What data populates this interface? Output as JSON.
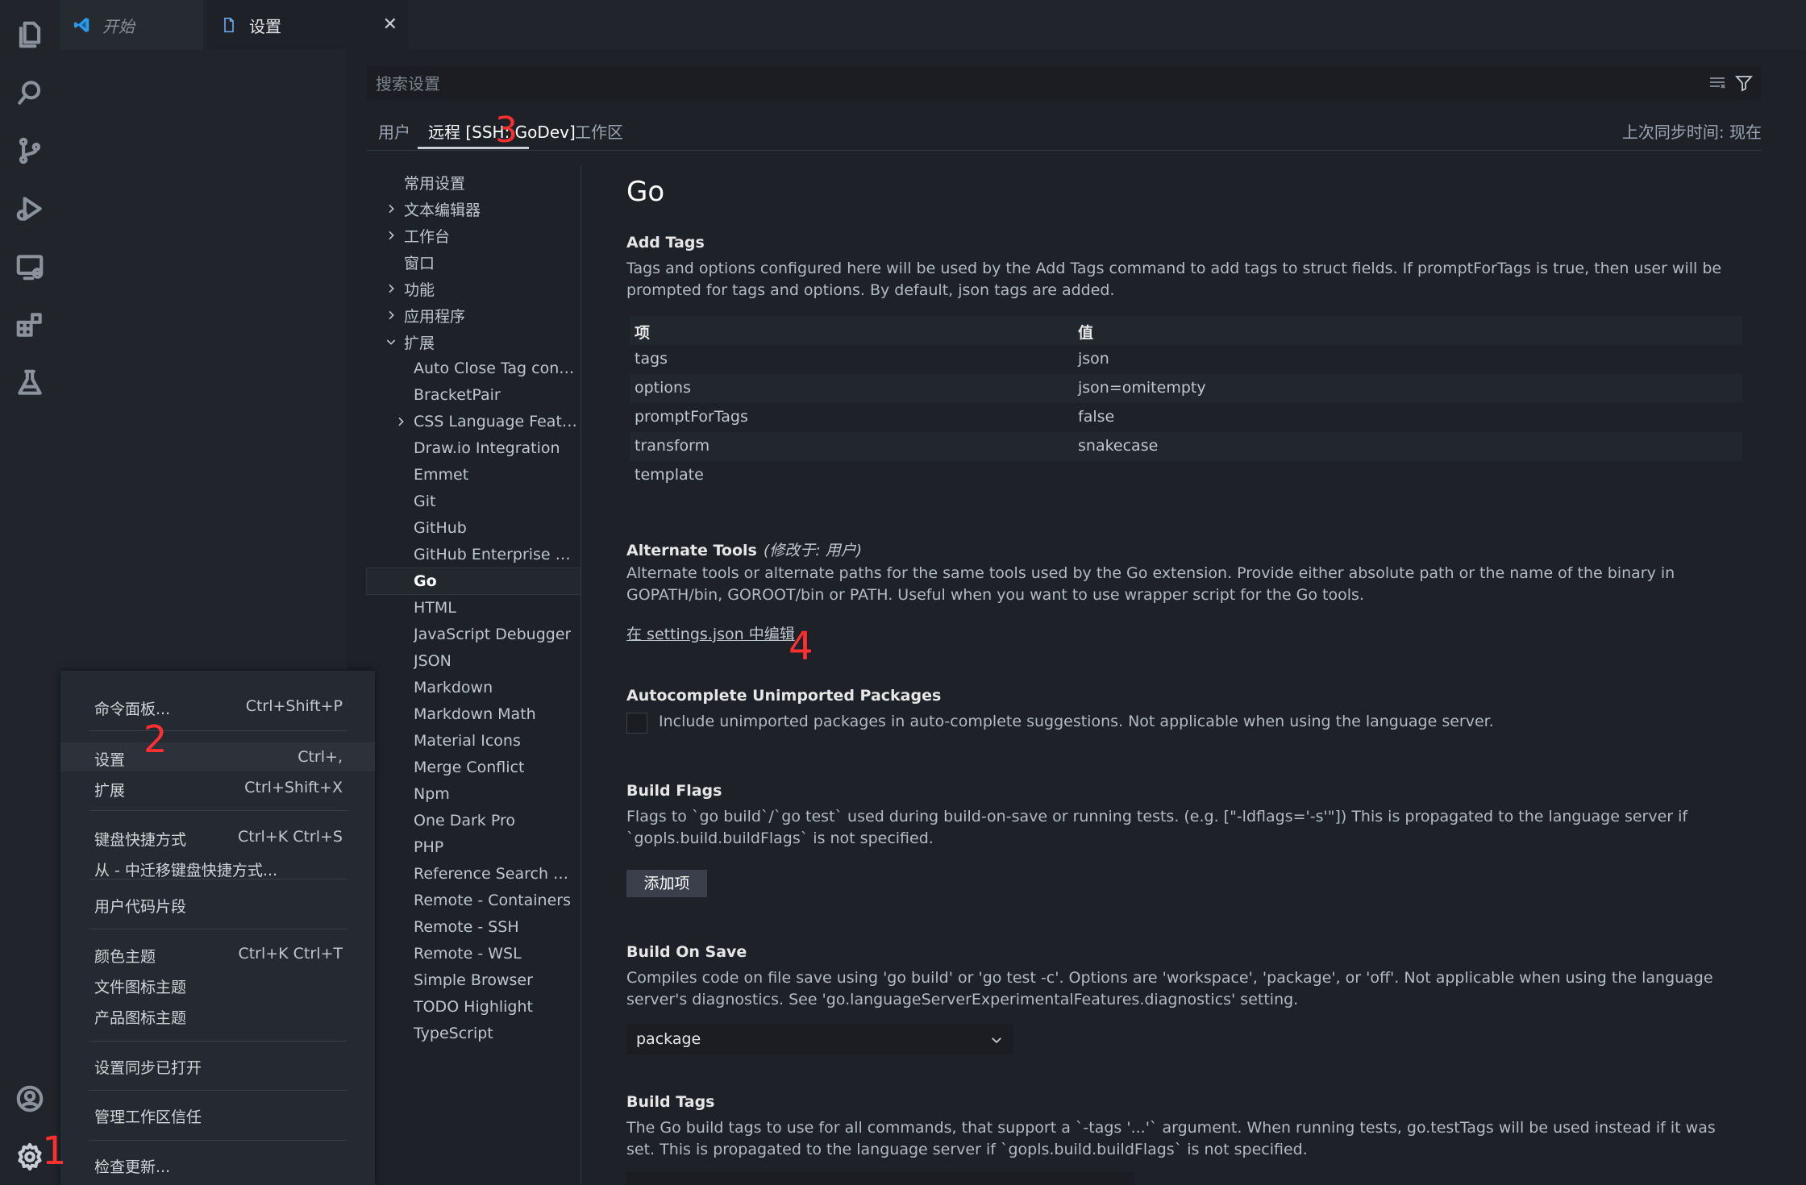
{
  "tabs": [
    {
      "label": "开始"
    },
    {
      "label": "设置"
    }
  ],
  "search": {
    "placeholder": "搜索设置"
  },
  "scope_tabs": [
    {
      "label": "用户"
    },
    {
      "label": "远程 [SSH: GoDev]"
    },
    {
      "label": "工作区"
    }
  ],
  "sync_status": "上次同步时间: 现在",
  "toc": [
    {
      "label": "常用设置",
      "indent": 0,
      "chevron": "none"
    },
    {
      "label": "文本编辑器",
      "indent": 0,
      "chevron": "right"
    },
    {
      "label": "工作台",
      "indent": 0,
      "chevron": "right"
    },
    {
      "label": "窗口",
      "indent": 0,
      "chevron": "none"
    },
    {
      "label": "功能",
      "indent": 0,
      "chevron": "right"
    },
    {
      "label": "应用程序",
      "indent": 0,
      "chevron": "right"
    },
    {
      "label": "扩展",
      "indent": 0,
      "chevron": "down"
    },
    {
      "label": "Auto Close Tag config...",
      "indent": 1,
      "chevron": "none"
    },
    {
      "label": "BracketPair",
      "indent": 1,
      "chevron": "none"
    },
    {
      "label": "CSS Language Features",
      "indent": 1,
      "chevron": "right"
    },
    {
      "label": "Draw.io Integration",
      "indent": 1,
      "chevron": "none"
    },
    {
      "label": "Emmet",
      "indent": 1,
      "chevron": "none"
    },
    {
      "label": "Git",
      "indent": 1,
      "chevron": "none"
    },
    {
      "label": "GitHub",
      "indent": 1,
      "chevron": "none"
    },
    {
      "label": "GitHub Enterprise Aut...",
      "indent": 1,
      "chevron": "none"
    },
    {
      "label": "Go",
      "indent": 1,
      "chevron": "none",
      "selected": true
    },
    {
      "label": "HTML",
      "indent": 1,
      "chevron": "none"
    },
    {
      "label": "JavaScript Debugger",
      "indent": 1,
      "chevron": "none"
    },
    {
      "label": "JSON",
      "indent": 1,
      "chevron": "none"
    },
    {
      "label": "Markdown",
      "indent": 1,
      "chevron": "none"
    },
    {
      "label": "Markdown Math",
      "indent": 1,
      "chevron": "none"
    },
    {
      "label": "Material Icons",
      "indent": 1,
      "chevron": "none"
    },
    {
      "label": "Merge Conflict",
      "indent": 1,
      "chevron": "none"
    },
    {
      "label": "Npm",
      "indent": 1,
      "chevron": "none"
    },
    {
      "label": "One Dark Pro",
      "indent": 1,
      "chevron": "none"
    },
    {
      "label": "PHP",
      "indent": 1,
      "chevron": "none"
    },
    {
      "label": "Reference Search View",
      "indent": 1,
      "chevron": "none"
    },
    {
      "label": "Remote - Containers",
      "indent": 1,
      "chevron": "none"
    },
    {
      "label": "Remote - SSH",
      "indent": 1,
      "chevron": "none"
    },
    {
      "label": "Remote - WSL",
      "indent": 1,
      "chevron": "none"
    },
    {
      "label": "Simple Browser",
      "indent": 1,
      "chevron": "none"
    },
    {
      "label": "TODO Highlight",
      "indent": 1,
      "chevron": "none"
    },
    {
      "label": "TypeScript",
      "indent": 1,
      "chevron": "none"
    }
  ],
  "content": {
    "heading": "Go",
    "add_tags": {
      "title": "Add Tags",
      "desc": "Tags and options configured here will be used by the Add Tags command to add tags to struct fields. If promptForTags is true, then user will be prompted for tags and options. By default, json tags are added.",
      "col_key": "项",
      "col_value": "值",
      "rows": [
        {
          "key": "tags",
          "value": "json"
        },
        {
          "key": "options",
          "value": "json=omitempty"
        },
        {
          "key": "promptForTags",
          "value": "false"
        },
        {
          "key": "transform",
          "value": "snakecase"
        },
        {
          "key": "template",
          "value": ""
        }
      ]
    },
    "alt_tools": {
      "title": "Alternate Tools",
      "modified": "(修改于: 用户)",
      "desc": "Alternate tools or alternate paths for the same tools used by the Go extension. Provide either absolute path or the name of the binary in GOPATH/bin, GOROOT/bin or PATH. Useful when you want to use wrapper script for the Go tools.",
      "link": "在 settings.json 中编辑"
    },
    "autocomplete": {
      "title": "Autocomplete Unimported Packages",
      "label": "Include unimported packages in auto-complete suggestions. Not applicable when using the language server."
    },
    "build_flags": {
      "title": "Build Flags",
      "desc": "Flags to `go build`/`go test` used during build-on-save or running tests. (e.g. [\"-ldflags='-s'\"]) This is propagated to the language server if `gopls.build.buildFlags` is not specified.",
      "button": "添加项"
    },
    "build_on_save": {
      "title": "Build On Save",
      "desc": "Compiles code on file save using 'go build' or 'go test -c'. Options are 'workspace', 'package', or 'off'. Not applicable when using the language server's diagnostics. See 'go.languageServerExperimentalFeatures.diagnostics' setting.",
      "value": "package"
    },
    "build_tags": {
      "title": "Build Tags",
      "desc": "The Go build tags to use for all commands, that support a `-tags '...'` argument. When running tests, go.testTags will be used instead if it was set. This is propagated to the language server if `gopls.build.buildFlags` is not specified."
    }
  },
  "menu": [
    {
      "label": "命令面板...",
      "shortcut": "Ctrl+Shift+P"
    },
    {
      "label": "设置",
      "shortcut": "Ctrl+,"
    },
    {
      "label": "扩展",
      "shortcut": "Ctrl+Shift+X"
    },
    {
      "label": "键盘快捷方式",
      "shortcut": "Ctrl+K Ctrl+S"
    },
    {
      "label": "从 - 中迁移键盘快捷方式...",
      "shortcut": ""
    },
    {
      "label": "用户代码片段",
      "shortcut": ""
    },
    {
      "label": "颜色主题",
      "shortcut": "Ctrl+K Ctrl+T"
    },
    {
      "label": "文件图标主题",
      "shortcut": ""
    },
    {
      "label": "产品图标主题",
      "shortcut": ""
    },
    {
      "label": "设置同步已打开",
      "shortcut": ""
    },
    {
      "label": "管理工作区信任",
      "shortcut": ""
    },
    {
      "label": "检查更新...",
      "shortcut": ""
    }
  ],
  "annotations": [
    "1",
    "2",
    "3",
    "4"
  ],
  "colors": {
    "annotation": "#ff3030",
    "background": "#1e2128",
    "activity_bar": "#21252b"
  }
}
